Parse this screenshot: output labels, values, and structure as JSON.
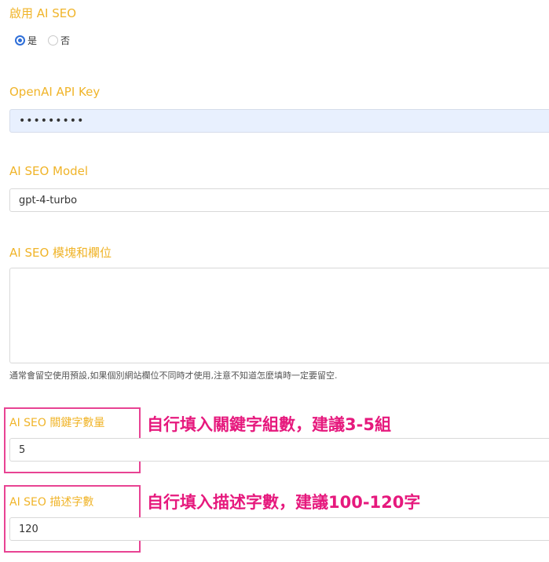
{
  "enable": {
    "label": "啟用 AI SEO",
    "options": [
      {
        "label": "是",
        "checked": true
      },
      {
        "label": "否",
        "checked": false
      }
    ]
  },
  "api_key": {
    "label": "OpenAI API Key",
    "value": "•••••••••"
  },
  "model": {
    "label": "AI SEO Model",
    "value": "gpt-4-turbo"
  },
  "fields": {
    "label": "AI SEO 模塊和欄位",
    "value": "",
    "help": "通常會留空使用預設,如果個別網站欄位不同時才使用,注意不知道怎麼填時一定要留空."
  },
  "keyword_count": {
    "label": "AI SEO 關鍵字數量",
    "value": "5",
    "annotation": "自行填入關鍵字組數，建議3-5組",
    "annotation_color": "#e6197d"
  },
  "desc_length": {
    "label": "AI SEO 描述字數",
    "value": "120",
    "annotation": "自行填入描述字數，建議100-120字",
    "annotation_color": "#e6197d"
  },
  "colors": {
    "label": "#f0b429",
    "radio_checked": "#2f6fd8",
    "password_bg": "#e8f0fe"
  }
}
